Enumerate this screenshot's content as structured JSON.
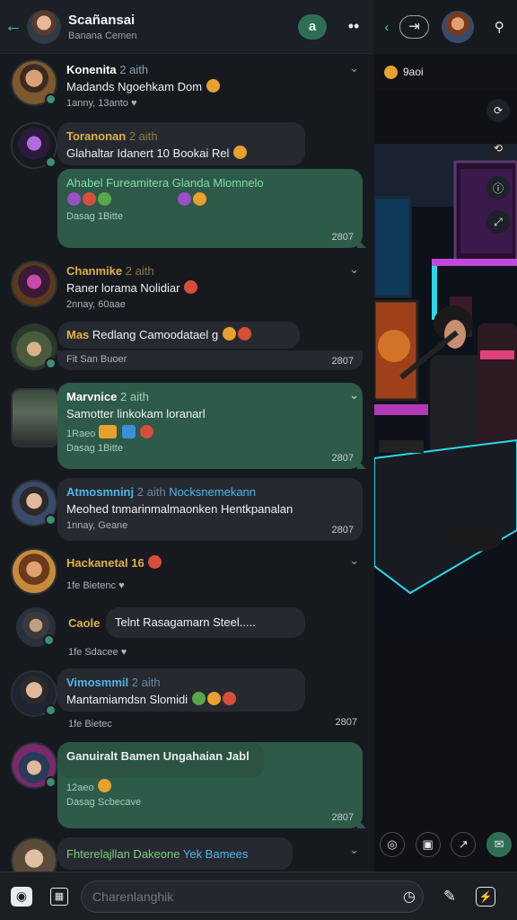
{
  "header": {
    "back_icon": "arrow-left-icon",
    "title": "Scañansai",
    "subtitle": "Banana Cemen",
    "pill": "a",
    "more": "••"
  },
  "messages": [
    {
      "name": "Konenita",
      "name_suffix": "2 aith",
      "name_color": "#ffffff",
      "text": "Madands Ngoehkam Dom",
      "meta": "1anny, 13anto ♥"
    },
    {
      "name": "Toranonan",
      "name_suffix": "2 aith",
      "name_color": "#e0b048",
      "text": "Glahaltar Idanert  10 Bookai  Rel"
    },
    {
      "name": "Ahabel Fureamitera Glanda  Mlomnelo",
      "text": "  ",
      "meta": "Dasag 1Bitte",
      "time": "2807"
    },
    {
      "name": "Chanmike",
      "name_suffix": "2 aith",
      "name_color": "#e0b048",
      "text": "Raner lorama Nolidiar",
      "meta": "2nnay, 60aae"
    },
    {
      "name": "Mas",
      "text": "Redlang Camoodatael g",
      "meta": "Fit  San  Buoer",
      "time": "2807"
    },
    {
      "name": "Marvnice",
      "name_suffix": "2 aith",
      "name_color": "#ffffff",
      "text": "Samotter linkokam loranarl",
      "meta": "1Raeo",
      "meta2": "Dasag 1Bitte",
      "time": "2807"
    },
    {
      "name": "Atmosmninj",
      "name_suffix": "2 aith",
      "tag": "Nocksnemekann",
      "name_color": "#4fb6e8",
      "text": "Meohed tnmarinmalmaonken  Hentkpanalan",
      "meta": "1nnay, Geane",
      "time": "2807"
    },
    {
      "name": "Hackanetal 16",
      "name_color": "#e0b048",
      "text": "",
      "meta": "1fe  Bietenc ♥"
    },
    {
      "name": "Caole",
      "name_color": "#e0b048",
      "text": "Telnt Rasagamarn Steel.....",
      "meta": "1fe  Sdacee ♥"
    },
    {
      "name": "Vimosmmil",
      "name_suffix": "2 aith",
      "name_color": "#4fb6e8",
      "text": "Mantamiamdsn  Slomidi",
      "meta": "1fe  Bietec",
      "time": "2807"
    },
    {
      "name": "Ganuiralt Bamen Ungahaian Jabl",
      "name_color": "#ffffff",
      "text": "",
      "meta": "12aeo",
      "meta2": "Dasag Scbecave",
      "time": "2807"
    },
    {
      "name": "Fhterelajllan Dakeone",
      "tag": "Yek Bamees",
      "name_color": "#7ecf7a",
      "text": ""
    }
  ],
  "composer": {
    "placeholder": "Charenlanghik"
  },
  "right": {
    "stream_label": "9aoi",
    "icons": {
      "back": "chevron-left-icon",
      "share": "share-icon",
      "search": "search-icon"
    }
  },
  "colors": {
    "accent": "#2f6e55",
    "bubble_green": "#2e5a49",
    "bubble_dark": "#262a30",
    "background": "#161a1f"
  }
}
